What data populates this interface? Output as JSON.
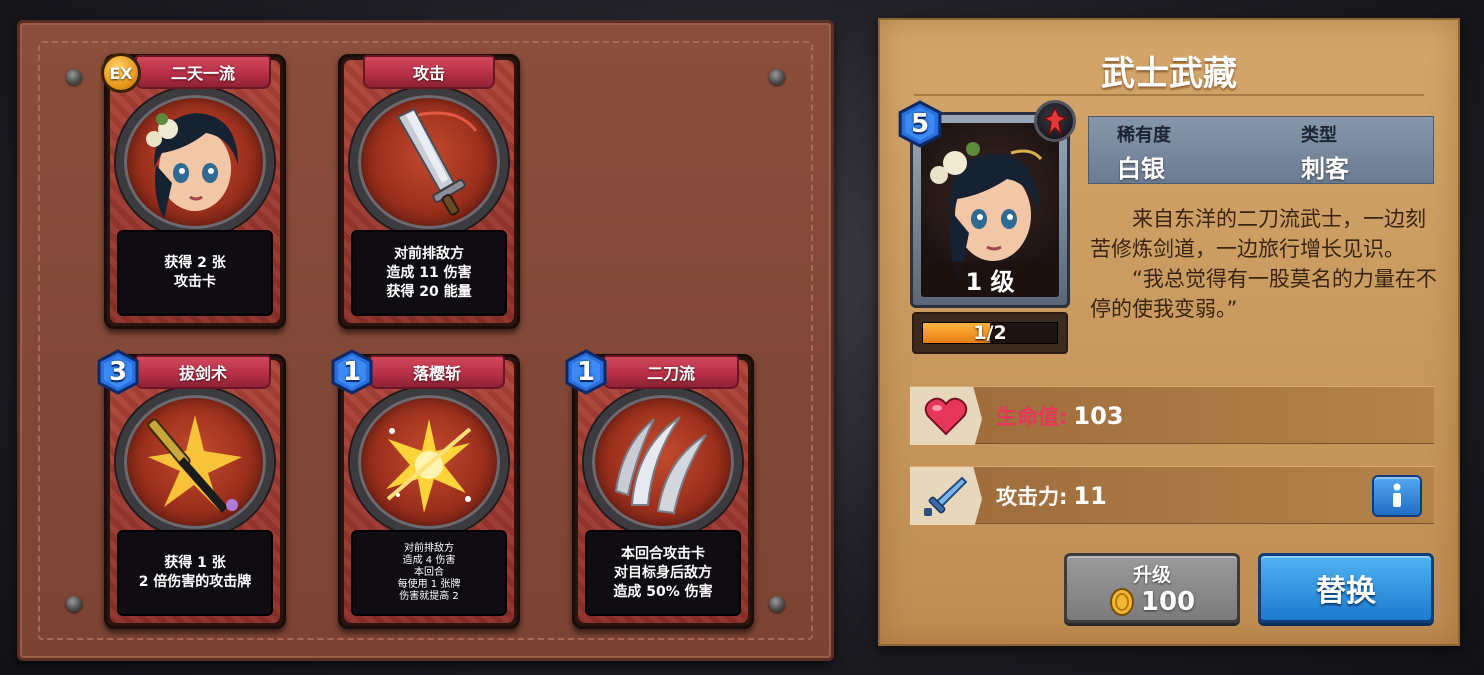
{
  "cards": [
    {
      "title": "二天一流",
      "badge": "EX",
      "cost": null,
      "desc": [
        "获得 2 张",
        "攻击卡"
      ],
      "art": "portrait-icon"
    },
    {
      "title": "攻击",
      "badge": null,
      "cost": null,
      "desc": [
        "对前排敌方",
        "造成 11 伤害",
        "获得 20 能量"
      ],
      "art": "sword-icon"
    },
    {
      "title": "拔剑术",
      "badge": null,
      "cost": "3",
      "desc": [
        "获得 1 张",
        "2 倍伤害的攻击牌"
      ],
      "art": "katana-icon"
    },
    {
      "title": "落樱斩",
      "badge": null,
      "cost": "1",
      "desc": [
        "对前排敌方",
        "造成 4 伤害",
        "本回合",
        "每使用 1 张牌",
        "伤害就提高 2"
      ],
      "art": "burst-icon"
    },
    {
      "title": "二刀流",
      "badge": null,
      "cost": "1",
      "desc": [
        "本回合攻击卡",
        "对目标身后敌方",
        "造成 50% 伤害"
      ],
      "art": "slash-icon"
    }
  ],
  "hero": {
    "name": "武士武藏",
    "cost": "5",
    "level": "1 级",
    "exp_text": "1/2",
    "exp_fraction": 0.5,
    "rarity_label": "稀有度",
    "rarity_value": "白银",
    "type_label": "类型",
    "type_value": "刺客",
    "bio": [
      "来自东洋的二刀流武士，一边刻苦修炼剑道，一边旅行增长见识。",
      "“我总觉得有一股莫名的力量在不停的使我变弱。”"
    ],
    "hp_label": "生命值:",
    "hp_value": "103",
    "atk_label": "攻击力:",
    "atk_value": "11"
  },
  "buttons": {
    "upgrade_label": "升级",
    "upgrade_price": "100",
    "replace_label": "替换"
  },
  "colors": {
    "hp_label": "#e8365a",
    "atk_label": "#ffffff",
    "cost_gem": "#2a6fe0",
    "ribbon": "#c23a50"
  }
}
